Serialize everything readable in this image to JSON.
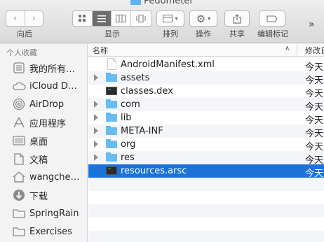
{
  "window": {
    "title": "Pedometer"
  },
  "toolbar": {
    "back_label": "向后",
    "view_label": "显示",
    "arrange_label": "排列",
    "action_label": "操作",
    "share_label": "共享",
    "tags_label": "编辑标记",
    "more": "»"
  },
  "sidebar": {
    "heading": "个人收藏",
    "items": [
      {
        "label": "我的所有…",
        "icon": "all-files-icon"
      },
      {
        "label": "iCloud D…",
        "icon": "icloud-drive-icon"
      },
      {
        "label": "AirDrop",
        "icon": "airdrop-icon"
      },
      {
        "label": "应用程序",
        "icon": "applications-icon"
      },
      {
        "label": "桌面",
        "icon": "desktop-icon"
      },
      {
        "label": "文稿",
        "icon": "documents-icon"
      },
      {
        "label": "wangche…",
        "icon": "home-icon"
      },
      {
        "label": "下载",
        "icon": "downloads-icon"
      },
      {
        "label": "SpringRain",
        "icon": "folder-icon"
      },
      {
        "label": "Exercises",
        "icon": "folder-icon"
      }
    ]
  },
  "list": {
    "name_header": "名称",
    "date_header": "修改日",
    "rows": [
      {
        "name": "AndroidManifest.xml",
        "date": "今天",
        "kind": "doc",
        "expandable": false,
        "selected": false
      },
      {
        "name": "assets",
        "date": "今天",
        "kind": "folder",
        "expandable": true,
        "selected": false
      },
      {
        "name": "classes.dex",
        "date": "今天",
        "kind": "exec",
        "expandable": false,
        "selected": false
      },
      {
        "name": "com",
        "date": "今天",
        "kind": "folder",
        "expandable": true,
        "selected": false
      },
      {
        "name": "lib",
        "date": "今天",
        "kind": "folder",
        "expandable": true,
        "selected": false
      },
      {
        "name": "META-INF",
        "date": "今天",
        "kind": "folder",
        "expandable": true,
        "selected": false
      },
      {
        "name": "org",
        "date": "今天",
        "kind": "folder",
        "expandable": true,
        "selected": false
      },
      {
        "name": "res",
        "date": "今天",
        "kind": "folder",
        "expandable": true,
        "selected": false
      },
      {
        "name": "resources.arsc",
        "date": "今天",
        "kind": "exec",
        "expandable": false,
        "selected": true
      }
    ]
  },
  "colors": {
    "selection": "#1a73d8",
    "folder": "#67bdf3"
  }
}
